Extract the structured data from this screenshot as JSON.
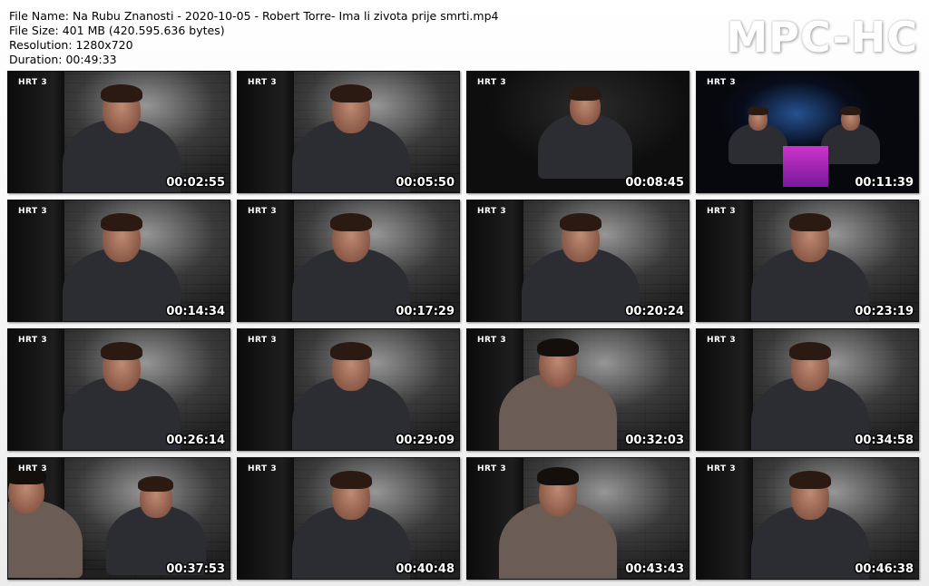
{
  "header": {
    "file_name": "File Name: Na Rubu Znanosti - 2020-10-05 - Robert Torre- Ima li zivota prije smrti.mp4",
    "file_size": "File Size: 401 MB (420.595.636 bytes)",
    "resolution": "Resolution: 1280x720",
    "duration": "Duration: 00:49:33"
  },
  "logo": "MPC-HC",
  "channel_label": "HRT 3",
  "thumbnails": [
    {
      "time": "00:02:55",
      "scene": "host-closeup"
    },
    {
      "time": "00:05:50",
      "scene": "host-closeup"
    },
    {
      "time": "00:08:45",
      "scene": "host-seated-dark"
    },
    {
      "time": "00:11:39",
      "scene": "studio-wide"
    },
    {
      "time": "00:14:34",
      "scene": "host-closeup"
    },
    {
      "time": "00:17:29",
      "scene": "host-closeup"
    },
    {
      "time": "00:20:24",
      "scene": "host-closeup"
    },
    {
      "time": "00:23:19",
      "scene": "host-closeup"
    },
    {
      "time": "00:26:14",
      "scene": "host-closeup"
    },
    {
      "time": "00:29:09",
      "scene": "host-closeup"
    },
    {
      "time": "00:32:03",
      "scene": "guest-closeup"
    },
    {
      "time": "00:34:58",
      "scene": "host-closeup"
    },
    {
      "time": "00:37:53",
      "scene": "over-shoulder"
    },
    {
      "time": "00:40:48",
      "scene": "host-closeup"
    },
    {
      "time": "00:43:43",
      "scene": "guest-closeup"
    },
    {
      "time": "00:46:38",
      "scene": "host-closeup"
    }
  ]
}
